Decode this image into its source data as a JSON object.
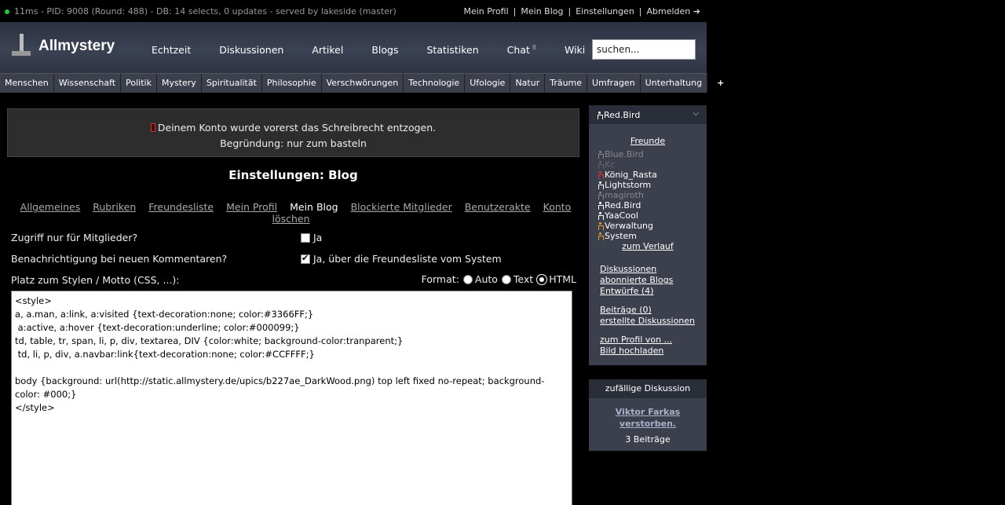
{
  "status": {
    "info": "11ms - PID: 9008 (Round: 488) - DB: 14 selects, 0 updates - served by lakeside (master)",
    "links": [
      "Mein Profil",
      "Mein Blog",
      "Einstellungen",
      "Abmelden ➔"
    ]
  },
  "header": {
    "site_name": "Allmystery",
    "nav": [
      "Echtzeit",
      "Diskussionen",
      "Artikel",
      "Blogs",
      "Statistiken",
      "Chat",
      "Wiki"
    ],
    "chat_count": "8",
    "search_value": "suchen..."
  },
  "categories": [
    "Menschen",
    "Wissenschaft",
    "Politik",
    "Mystery",
    "Spiritualität",
    "Philosophie",
    "Verschwörungen",
    "Technologie",
    "Ufologie",
    "Natur",
    "Träume",
    "Umfragen",
    "Unterhaltung",
    "+"
  ],
  "notice": {
    "line1": "Deinem Konto wurde vorerst das Schreibrecht entzogen.",
    "line2": "Begründung: nur zum basteln"
  },
  "page": {
    "title": "Einstellungen: Blog",
    "tabs": [
      "Allgemeines",
      "Rubriken",
      "Freundesliste",
      "Mein Profil",
      "Mein Blog",
      "Blockierte Mitglieder",
      "Benutzerakte",
      "Konto löschen"
    ],
    "active_tab": "Mein Blog"
  },
  "form": {
    "access_label": "Zugriff nur für Mitglieder?",
    "access_option": "Ja",
    "access_checked": false,
    "notify_label": "Benachrichtigung bei neuen Kommentaren?",
    "notify_option": "Ja, über die Freundesliste vom System",
    "notify_checked": true,
    "style_label": "Platz zum Stylen / Motto (CSS, ...):",
    "format_label": "Format:",
    "format_options": [
      "Auto",
      "Text",
      "HTML"
    ],
    "format_selected": "HTML",
    "editor_content": "<style>\na, a.man, a:link, a:visited {text-decoration:none; color:#3366FF;}\n a:active, a:hover {text-decoration:underline; color:#000099;}\ntd, table, tr, span, li, p, div, textarea, DIV {color:white; background-color:tranparent;}\n td, li, p, div, a.navbar:link{text-decoration:none; color:#CCFFFF;}\n\nbody {background: url(http://static.allmystery.de/upics/b227ae_DarkWood.png) top left fixed no-repeat; background-color: #000;}\n</style>"
  },
  "sidebar": {
    "username": "Red.Bird",
    "friends_title": "Freunde",
    "friends": [
      {
        "name": "Blue.Bird",
        "color": "#888888"
      },
      {
        "name": "Kc",
        "color": "#666666"
      },
      {
        "name": "König_Rasta",
        "color": "#ffffff",
        "icon_color": "#e03030"
      },
      {
        "name": "Lightstorm",
        "color": "#ffffff"
      },
      {
        "name": "magiroth",
        "color": "#888888"
      },
      {
        "name": "Red.Bird",
        "color": "#ffffff"
      },
      {
        "name": "YaaCool",
        "color": "#ffffff"
      },
      {
        "name": "Verwaltung",
        "color": "#ffffff",
        "icon_color": "#e0a020"
      },
      {
        "name": "System",
        "color": "#ffffff",
        "icon_color": "#e0a020"
      }
    ],
    "history_link": "zum Verlauf",
    "links_group1": [
      "Diskussionen",
      "abonnierte Blogs",
      "Entwürfe (4)"
    ],
    "links_group2": [
      "Beiträge (0)",
      "erstellte Diskussionen"
    ],
    "links_group3": [
      "zum Profil von ...",
      "Bild hochladen"
    ]
  },
  "random": {
    "title": "zufällige Diskussion",
    "discussion": "Viktor Farkas verstorben.",
    "count": "3 Beiträge"
  }
}
